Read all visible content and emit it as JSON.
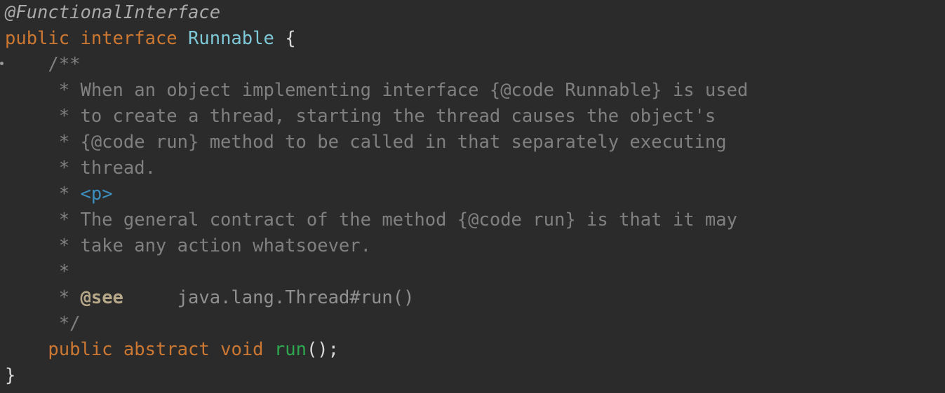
{
  "editor": {
    "language": "java",
    "theme_colors": {
      "background": "#2b2b2b",
      "keyword": "#cc7832",
      "class_name": "#7ec8d8",
      "method_name": "#2ea84f",
      "comment": "#808080",
      "annotation": "#aaaaaa",
      "html_tag": "#3c8fbf",
      "javadoc_tag": "#b8a88a"
    },
    "lines": {
      "l1": {
        "annotation": "@FunctionalInterface"
      },
      "l2": {
        "kw_public": "public",
        "kw_interface": "interface",
        "class_name": "Runnable",
        "brace": "{"
      },
      "l3": {
        "text": "/**"
      },
      "l4": {
        "text": "* When an object implementing interface {@code Runnable} is used"
      },
      "l5": {
        "text": "* to create a thread, starting the thread causes the object's"
      },
      "l6": {
        "text": "* {@code run} method to be called in that separately executing"
      },
      "l7": {
        "text": "* thread."
      },
      "l8": {
        "star": "*",
        "tag": "<p>"
      },
      "l9": {
        "text": "* The general contract of the method {@code run} is that it may"
      },
      "l10": {
        "text": "* take any action whatsoever."
      },
      "l11": {
        "text": "*"
      },
      "l12": {
        "star": "*",
        "see": "@see",
        "ref": "java.lang.Thread#run()"
      },
      "l13": {
        "text": "*/"
      },
      "l14": {
        "kw_public": "public",
        "kw_abstract": "abstract",
        "kw_void": "void",
        "method": "run",
        "punct": "();"
      },
      "l15": {
        "brace": "}"
      }
    }
  }
}
